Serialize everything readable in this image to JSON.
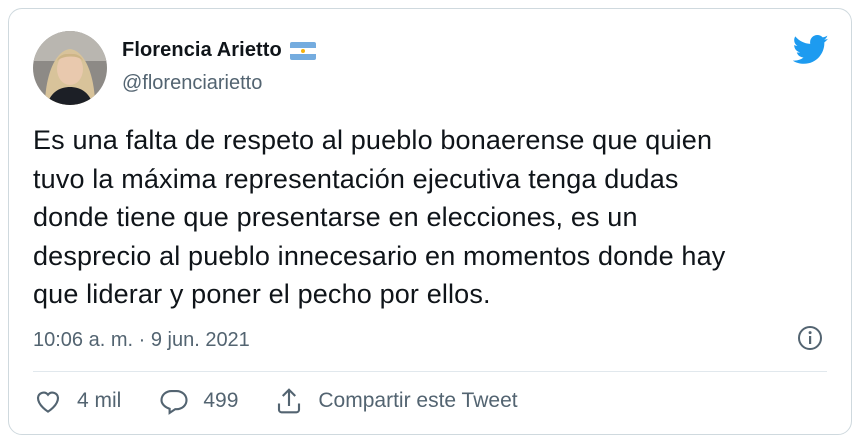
{
  "author": {
    "display_name": "Florencia Arietto",
    "handle": "@florenciarietto",
    "avatar_icon": "profile-photo",
    "badge_icon": "argentina-flag-icon"
  },
  "tweet": {
    "text": "Es una falta de respeto al pueblo bonaerense que quien\ntuvo la máxima representación ejecutiva tenga dudas\ndonde tiene que presentarse en elecciones, es un\ndesprecio al pueblo innecesario en momentos donde hay\nque liderar y poner el pecho por ellos.",
    "timestamp": "10:06 a. m. · 9 jun. 2021"
  },
  "actions": {
    "likes": "4 mil",
    "replies": "499",
    "share_label": "Compartir este Tweet"
  },
  "colors": {
    "brand": "#1d9bf0",
    "text": "#0f1419",
    "secondary": "#536471",
    "border": "#cfd9de"
  }
}
